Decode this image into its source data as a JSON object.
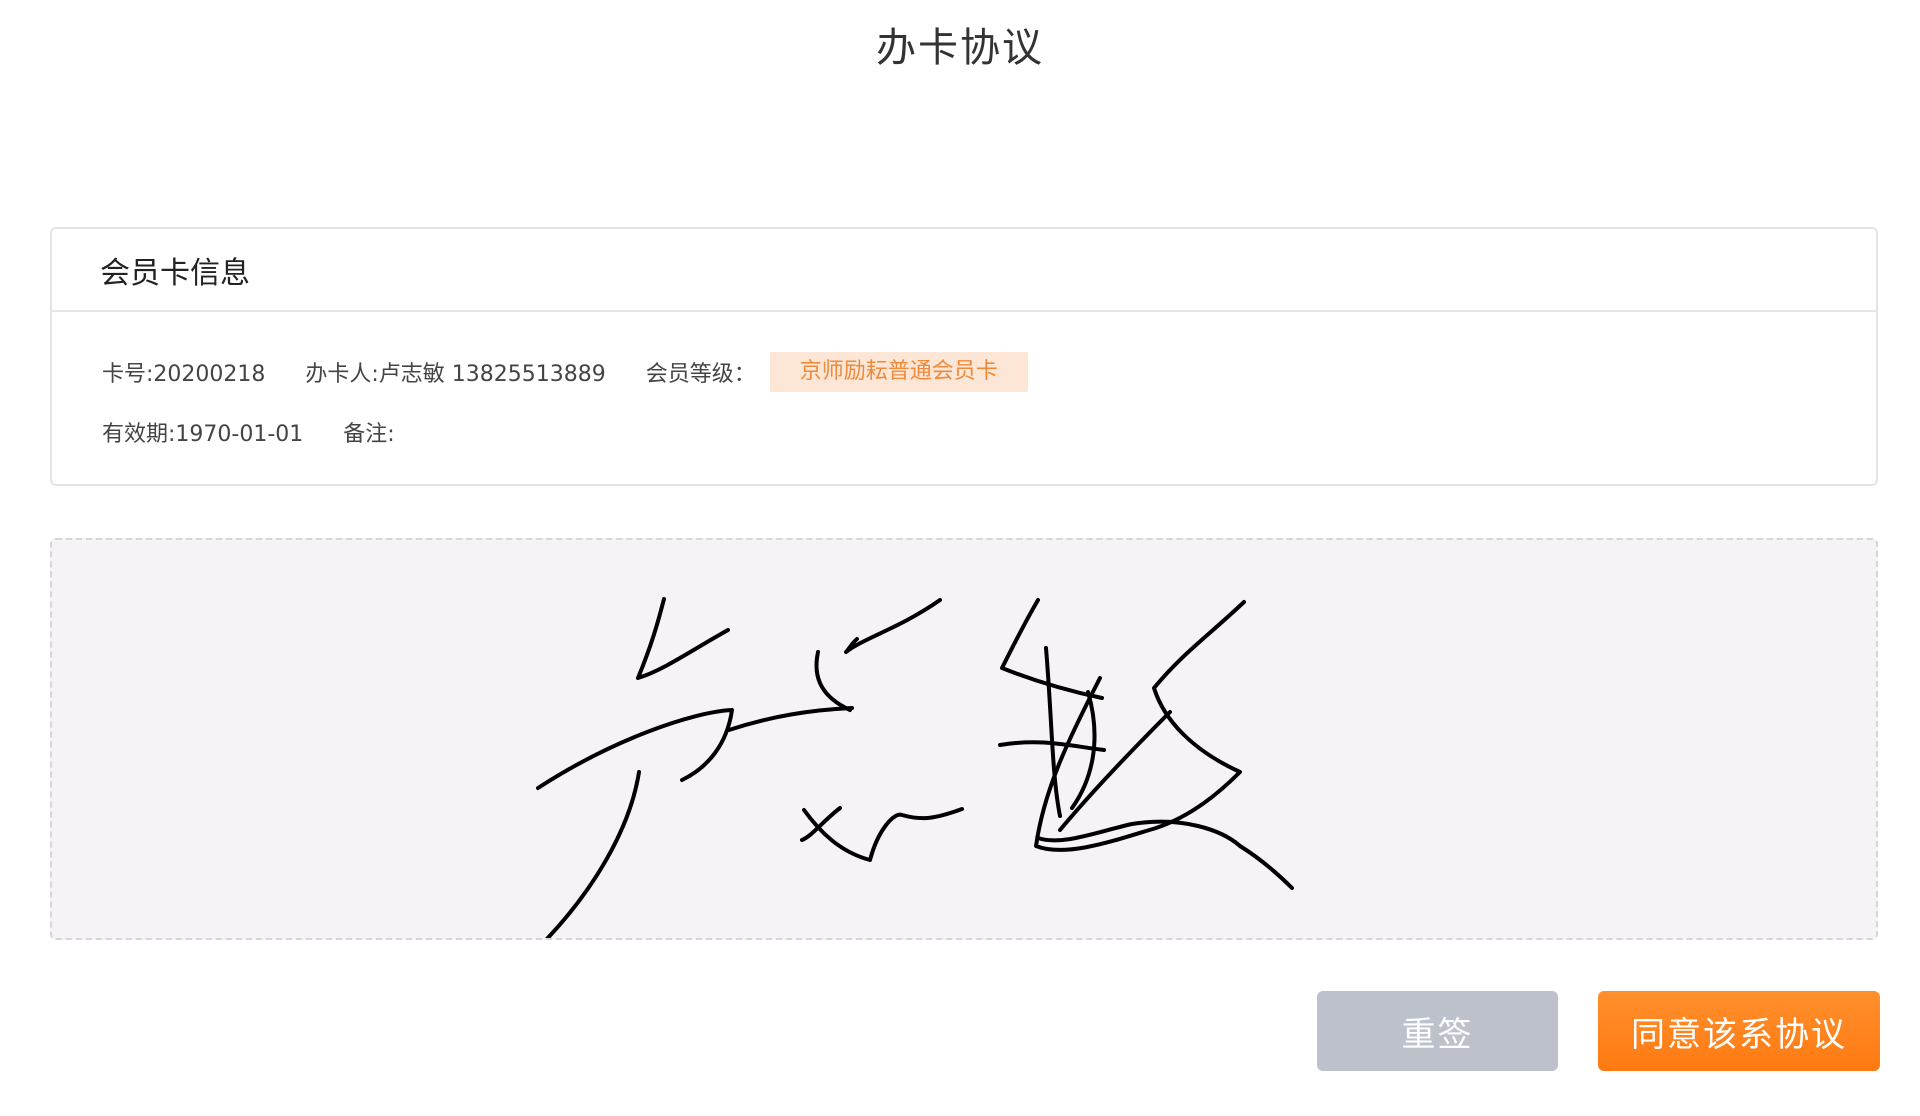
{
  "page": {
    "title": "办卡协议"
  },
  "member_card": {
    "header": "会员卡信息",
    "card_no": "卡号:20200218",
    "holder": "办卡人:卢志敏 13825513889",
    "level_label": "会员等级：",
    "level_value": "京师励耘普通会员卡",
    "valid_until": "有效期:1970-01-01",
    "remark": "备注:"
  },
  "signature": {
    "stroke_color": "#000000",
    "background_color": "#f6f3f6",
    "signed_name": "卢志敏"
  },
  "actions": {
    "resign_label": "重签",
    "agree_label": "同意该系协议"
  },
  "colors": {
    "accent_orange": "#ff8119",
    "badge_bg": "#fde6d6",
    "badge_text": "#ee8a3c",
    "resign_gray": "#bcc1cc"
  }
}
